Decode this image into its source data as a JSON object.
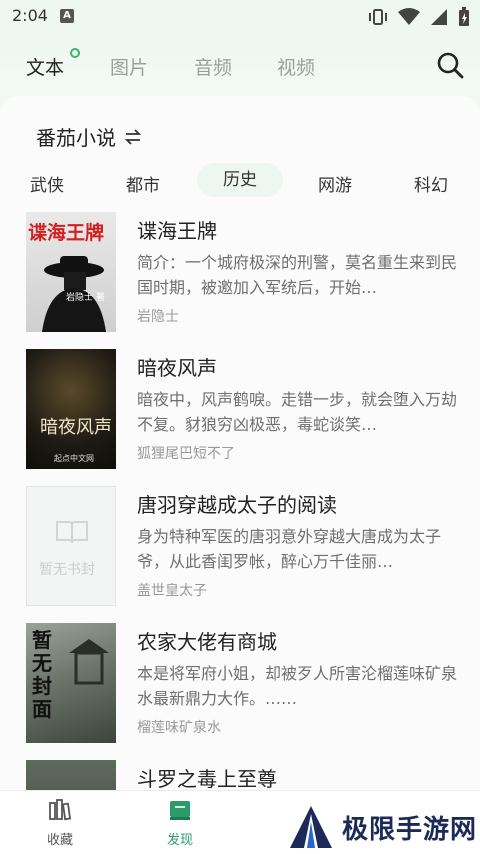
{
  "status": {
    "time": "2:04"
  },
  "tabs": [
    {
      "label": "文本",
      "active": true
    },
    {
      "label": "图片"
    },
    {
      "label": "音频"
    },
    {
      "label": "视频"
    }
  ],
  "source": {
    "name": "番茄小说",
    "switch_icon": "swap-icon"
  },
  "categories": [
    {
      "label": "武侠"
    },
    {
      "label": "都市"
    },
    {
      "label": "历史",
      "active": true
    },
    {
      "label": "网游"
    },
    {
      "label": "科幻"
    }
  ],
  "books": [
    {
      "title": "谍海王牌",
      "desc": "简介：一个城府极深的刑警，莫名重生来到民国时期，被邀加入军统后，开始…",
      "author": "岩隐士",
      "cover_title": "谍海王牌",
      "cover_author": "岩隐士 著"
    },
    {
      "title": "暗夜风声",
      "desc": "暗夜中，风声鹤唳。走错一步，就会堕入万劫不复。豺狼穷凶极恶，毒蛇谈笑…",
      "author": "狐狸尾巴短不了",
      "cover_title": "暗夜风声",
      "cover_footer": "起点中文网"
    },
    {
      "title": "唐羽穿越成太子的阅读",
      "desc": "身为特种军医的唐羽意外穿越大唐成为太子爷，从此香闺罗帐，醉心万千佳丽…",
      "author": "盖世皇太子",
      "cover_placeholder": "暂无书封"
    },
    {
      "title": "农家大佬有商城",
      "desc": "本是将军府小姐，却被歹人所害沦榴莲味矿泉水最新鼎力大作。……",
      "author": "榴莲味矿泉水",
      "cover_title": "暂无封面"
    },
    {
      "title": "斗罗之毒上至尊"
    }
  ],
  "bottom_nav": [
    {
      "label": "收藏",
      "icon": "bookshelf-icon"
    },
    {
      "label": "发现",
      "icon": "discover-icon",
      "active": true
    }
  ],
  "watermark": {
    "text": "极限手游网"
  },
  "colors": {
    "accent": "#2c9b6c",
    "dot": "#3bb56a",
    "brand_navy": "#1c2a58"
  }
}
